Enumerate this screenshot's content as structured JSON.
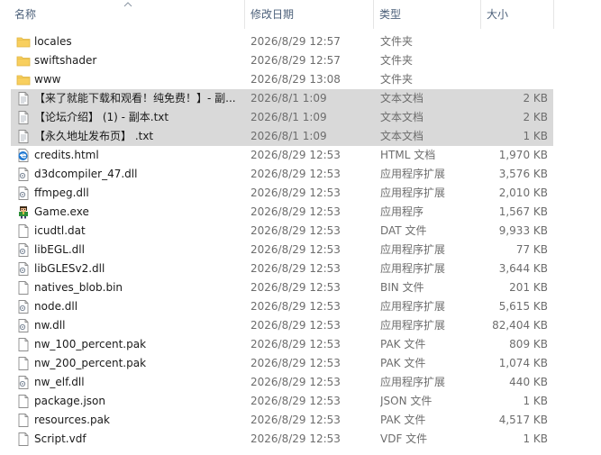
{
  "columns": {
    "name": "名称",
    "date": "修改日期",
    "type": "类型",
    "size": "大小"
  },
  "sort": {
    "column": "name",
    "direction": "ascending"
  },
  "colors": {
    "header_text": "#4c607a",
    "selection": "#d9d9d9",
    "folder": "#f8cf5e"
  },
  "files": [
    {
      "name": "locales",
      "date": "2026/8/29 12:57",
      "type": "文件夹",
      "size": "",
      "icon": "folder-icon",
      "selected": false
    },
    {
      "name": "swiftshader",
      "date": "2026/8/29 12:57",
      "type": "文件夹",
      "size": "",
      "icon": "folder-icon",
      "selected": false
    },
    {
      "name": "www",
      "date": "2026/8/29 13:08",
      "type": "文件夹",
      "size": "",
      "icon": "folder-icon",
      "selected": false
    },
    {
      "name": "【来了就能下载和观看！纯免费！】- 副...",
      "date": "2026/8/1 1:09",
      "type": "文本文档",
      "size": "2 KB",
      "icon": "text-file-icon",
      "selected": true
    },
    {
      "name": "【论坛介绍】 (1) - 副本.txt",
      "date": "2026/8/1 1:09",
      "type": "文本文档",
      "size": "2 KB",
      "icon": "text-file-icon",
      "selected": true
    },
    {
      "name": "【永久地址发布页】 .txt",
      "date": "2026/8/1 1:09",
      "type": "文本文档",
      "size": "1 KB",
      "icon": "text-file-icon",
      "selected": true
    },
    {
      "name": "credits.html",
      "date": "2026/8/29 12:53",
      "type": "HTML 文档",
      "size": "1,970 KB",
      "icon": "edge-html-icon",
      "selected": false
    },
    {
      "name": "d3dcompiler_47.dll",
      "date": "2026/8/29 12:53",
      "type": "应用程序扩展",
      "size": "3,576 KB",
      "icon": "dll-file-icon",
      "selected": false
    },
    {
      "name": "ffmpeg.dll",
      "date": "2026/8/29 12:53",
      "type": "应用程序扩展",
      "size": "2,010 KB",
      "icon": "dll-file-icon",
      "selected": false
    },
    {
      "name": "Game.exe",
      "date": "2026/8/29 12:53",
      "type": "应用程序",
      "size": "1,567 KB",
      "icon": "game-exe-icon",
      "selected": false
    },
    {
      "name": "icudtl.dat",
      "date": "2026/8/29 12:53",
      "type": "DAT 文件",
      "size": "9,933 KB",
      "icon": "blank-file-icon",
      "selected": false
    },
    {
      "name": "libEGL.dll",
      "date": "2026/8/29 12:53",
      "type": "应用程序扩展",
      "size": "77 KB",
      "icon": "dll-file-icon",
      "selected": false
    },
    {
      "name": "libGLESv2.dll",
      "date": "2026/8/29 12:53",
      "type": "应用程序扩展",
      "size": "3,644 KB",
      "icon": "dll-file-icon",
      "selected": false
    },
    {
      "name": "natives_blob.bin",
      "date": "2026/8/29 12:53",
      "type": "BIN 文件",
      "size": "201 KB",
      "icon": "blank-file-icon",
      "selected": false
    },
    {
      "name": "node.dll",
      "date": "2026/8/29 12:53",
      "type": "应用程序扩展",
      "size": "5,615 KB",
      "icon": "dll-file-icon",
      "selected": false
    },
    {
      "name": "nw.dll",
      "date": "2026/8/29 12:53",
      "type": "应用程序扩展",
      "size": "82,404 KB",
      "icon": "dll-file-icon",
      "selected": false
    },
    {
      "name": "nw_100_percent.pak",
      "date": "2026/8/29 12:53",
      "type": "PAK 文件",
      "size": "809 KB",
      "icon": "blank-file-icon",
      "selected": false
    },
    {
      "name": "nw_200_percent.pak",
      "date": "2026/8/29 12:53",
      "type": "PAK 文件",
      "size": "1,074 KB",
      "icon": "blank-file-icon",
      "selected": false
    },
    {
      "name": "nw_elf.dll",
      "date": "2026/8/29 12:53",
      "type": "应用程序扩展",
      "size": "440 KB",
      "icon": "dll-file-icon",
      "selected": false
    },
    {
      "name": "package.json",
      "date": "2026/8/29 12:53",
      "type": "JSON 文件",
      "size": "1 KB",
      "icon": "blank-file-icon",
      "selected": false
    },
    {
      "name": "resources.pak",
      "date": "2026/8/29 12:53",
      "type": "PAK 文件",
      "size": "4,517 KB",
      "icon": "blank-file-icon",
      "selected": false
    },
    {
      "name": "Script.vdf",
      "date": "2026/8/29 12:53",
      "type": "VDF 文件",
      "size": "1 KB",
      "icon": "blank-file-icon",
      "selected": false
    }
  ]
}
